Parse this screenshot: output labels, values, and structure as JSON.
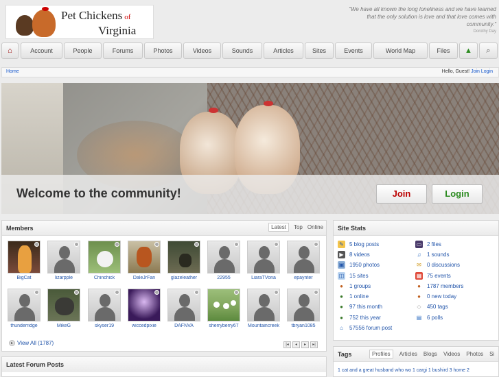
{
  "site": {
    "title_line1": "Pet Chickens",
    "title_of": "of",
    "title_line2": "Virginia",
    "quote": "\"We have all known the long loneliness and we have learned that the only solution is love and that love comes with community.\"",
    "quote_author": "Dorothy Day"
  },
  "nav": {
    "home_icon": "home-icon",
    "items": [
      "Account",
      "People",
      "Forums",
      "Photos",
      "Videos",
      "Sounds",
      "Articles",
      "Sites",
      "Events",
      "World Map",
      "Files"
    ],
    "upload_icon": "upload-icon",
    "search_icon": "search-icon"
  },
  "breadcrumb": {
    "home": "Home",
    "greeting": "Hello, Guest!",
    "join": "Join",
    "login": "Login"
  },
  "hero": {
    "welcome": "Welcome to the community!",
    "join_label": "Join",
    "login_label": "Login"
  },
  "members": {
    "title": "Members",
    "tabs": [
      "Latest",
      "Top",
      "Online"
    ],
    "list": [
      {
        "name": "BigCat"
      },
      {
        "name": "lizarpple"
      },
      {
        "name": "Chinchick"
      },
      {
        "name": "DaleJrFan"
      },
      {
        "name": "glazeleather"
      },
      {
        "name": "22955"
      },
      {
        "name": "LiaraTVona"
      },
      {
        "name": "epaynter"
      },
      {
        "name": "thunderridge"
      },
      {
        "name": "MikeG"
      },
      {
        "name": "skyser19"
      },
      {
        "name": "wiccedpixie"
      },
      {
        "name": "DAFNVA"
      },
      {
        "name": "sherryberry67"
      },
      {
        "name": "Mountaincreek"
      },
      {
        "name": "tbryan1085"
      }
    ],
    "view_all": "View All (1787)"
  },
  "site_stats": {
    "title": "Site Stats",
    "left": [
      {
        "label": "5 blog posts",
        "icon": "blog-icon"
      },
      {
        "label": "8 videos",
        "icon": "video-icon"
      },
      {
        "label": "1950 photos",
        "icon": "photo-icon"
      },
      {
        "label": "15 sites",
        "icon": "sites-icon"
      },
      {
        "label": "1 groups",
        "icon": "groups-icon"
      },
      {
        "label": "1 online",
        "icon": "online-icon"
      },
      {
        "label": "97 this month",
        "icon": "month-icon"
      },
      {
        "label": "752 this year",
        "icon": "year-icon"
      },
      {
        "label": "57556 forum post",
        "icon": "forum-icon"
      }
    ],
    "right": [
      {
        "label": "2 files",
        "icon": "files-icon"
      },
      {
        "label": "1 sounds",
        "icon": "sound-icon"
      },
      {
        "label": "0 discussions",
        "icon": "discussion-icon"
      },
      {
        "label": "75 events",
        "icon": "events-icon"
      },
      {
        "label": "1787 members",
        "icon": "members-icon"
      },
      {
        "label": "0 new today",
        "icon": "new-today-icon"
      },
      {
        "label": "450 tags",
        "icon": "tags-icon"
      },
      {
        "label": "6 polls",
        "icon": "polls-icon"
      }
    ]
  },
  "tags": {
    "title": "Tags",
    "tabs": [
      "Profiles",
      "Articles",
      "Blogs",
      "Videos",
      "Photos",
      "Si"
    ],
    "preview": "1 cat and a great husband who wo 1 cargi 1 bushird 3 home 2"
  },
  "forum": {
    "title": "Latest Forum Posts"
  }
}
